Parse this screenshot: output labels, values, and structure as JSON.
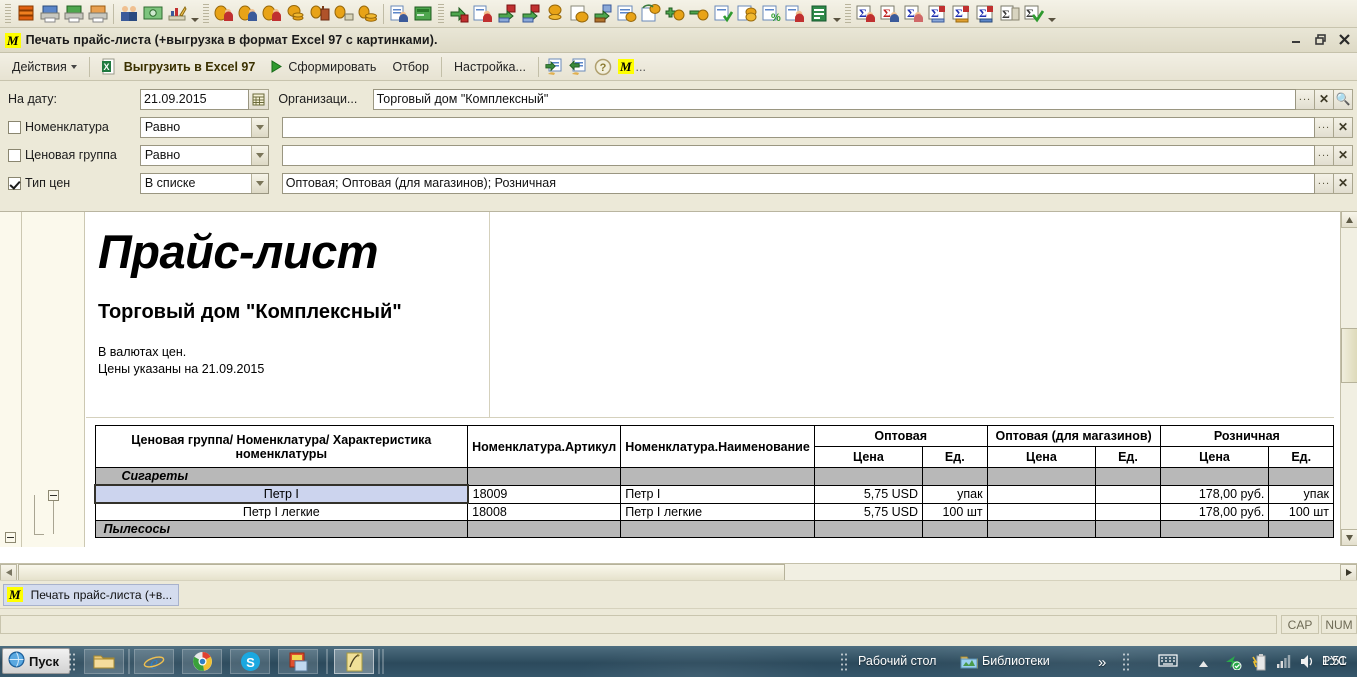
{
  "window": {
    "title": "Печать прайс-листа (+выгрузка в формат Excel 97 с картинками).",
    "badge": "M",
    "minimize": "–",
    "restore": "❐",
    "close": "✕"
  },
  "menubar": {
    "actions_label": "Действия",
    "export_label": "Выгрузить в Excel 97",
    "generate_label": "Сформировать",
    "filter_label": "Отбор",
    "settings_label": "Настройка...",
    "help_label": "?",
    "m_label": "M",
    "ellipsis": "..."
  },
  "filters": {
    "date_label": "На дату:",
    "date_value": "21.09.2015",
    "org_label": "Организаци...",
    "org_value": "Торговый дом \"Комплексный\"",
    "rows": [
      {
        "label": "Номенклатура",
        "checked": false,
        "condition": "Равно",
        "value": ""
      },
      {
        "label": "Ценовая группа",
        "checked": false,
        "condition": "Равно",
        "value": ""
      },
      {
        "label": "Тип цен",
        "checked": true,
        "condition": "В списке",
        "value": "Оптовая; Оптовая (для магазинов); Розничная"
      }
    ],
    "btn_dots": "...",
    "btn_clear": "✕",
    "btn_search": "🔍"
  },
  "document": {
    "title": "Прайс-лист",
    "organization": "Торговый дом \"Комплексный\"",
    "note_line1": "В валютах цен.",
    "note_line2": "Цены указаны на 21.09.2015"
  },
  "table": {
    "header": {
      "col_group": "Ценовая группа/ Номенклатура/ Характеристика номенклатуры",
      "col_article": "Номенклатура.Артикул",
      "col_name": "Номенклатура.Наименование",
      "price_types": [
        "Оптовая",
        "Оптовая (для магазинов)",
        "Розничная"
      ],
      "sub_price": "Цена",
      "sub_unit": "Ед."
    },
    "rows": [
      {
        "type": "group",
        "name": "Сигареты",
        "article": "",
        "goods_name": "",
        "opt_price": "",
        "opt_unit": "",
        "shop_price": "",
        "shop_unit": "",
        "retail_price": "",
        "retail_unit": ""
      },
      {
        "type": "item",
        "selected": true,
        "name": "Петр I",
        "article": "18009",
        "goods_name": "Петр I",
        "opt_price": "5,75 USD",
        "opt_unit": "упак",
        "shop_price": "",
        "shop_unit": "",
        "retail_price": "178,00 руб.",
        "retail_unit": "упак"
      },
      {
        "type": "item",
        "selected": false,
        "name": "Петр I легкие",
        "article": "18008",
        "goods_name": "Петр I легкие",
        "opt_price": "5,75 USD",
        "opt_unit": "100 шт",
        "shop_price": "",
        "shop_unit": "",
        "retail_price": "178,00 руб.",
        "retail_unit": "100 шт"
      },
      {
        "type": "group",
        "name": "Пылесосы",
        "article": "",
        "goods_name": "",
        "opt_price": "",
        "opt_unit": "",
        "shop_price": "",
        "shop_unit": "",
        "retail_price": "",
        "retail_unit": ""
      }
    ]
  },
  "apptaskbar": {
    "badge": "M",
    "task_label": "Печать прайс-листа (+в..."
  },
  "statusbar": {
    "cap": "CAP",
    "num": "NUM"
  },
  "taskbar": {
    "start_label": "Пуск",
    "desktop_label": "Рабочий стол",
    "libraries_label": "Библиотеки",
    "overflow": "»",
    "language": "РУС",
    "clock": "1:51"
  },
  "colors": {
    "accent_yellow": "#ffff00",
    "selection_blue": "#ccd4ee",
    "group_gray": "#b8b8b8",
    "panel_beige": "#ece9d8",
    "taskbar_teal": "#2c4a5c"
  }
}
